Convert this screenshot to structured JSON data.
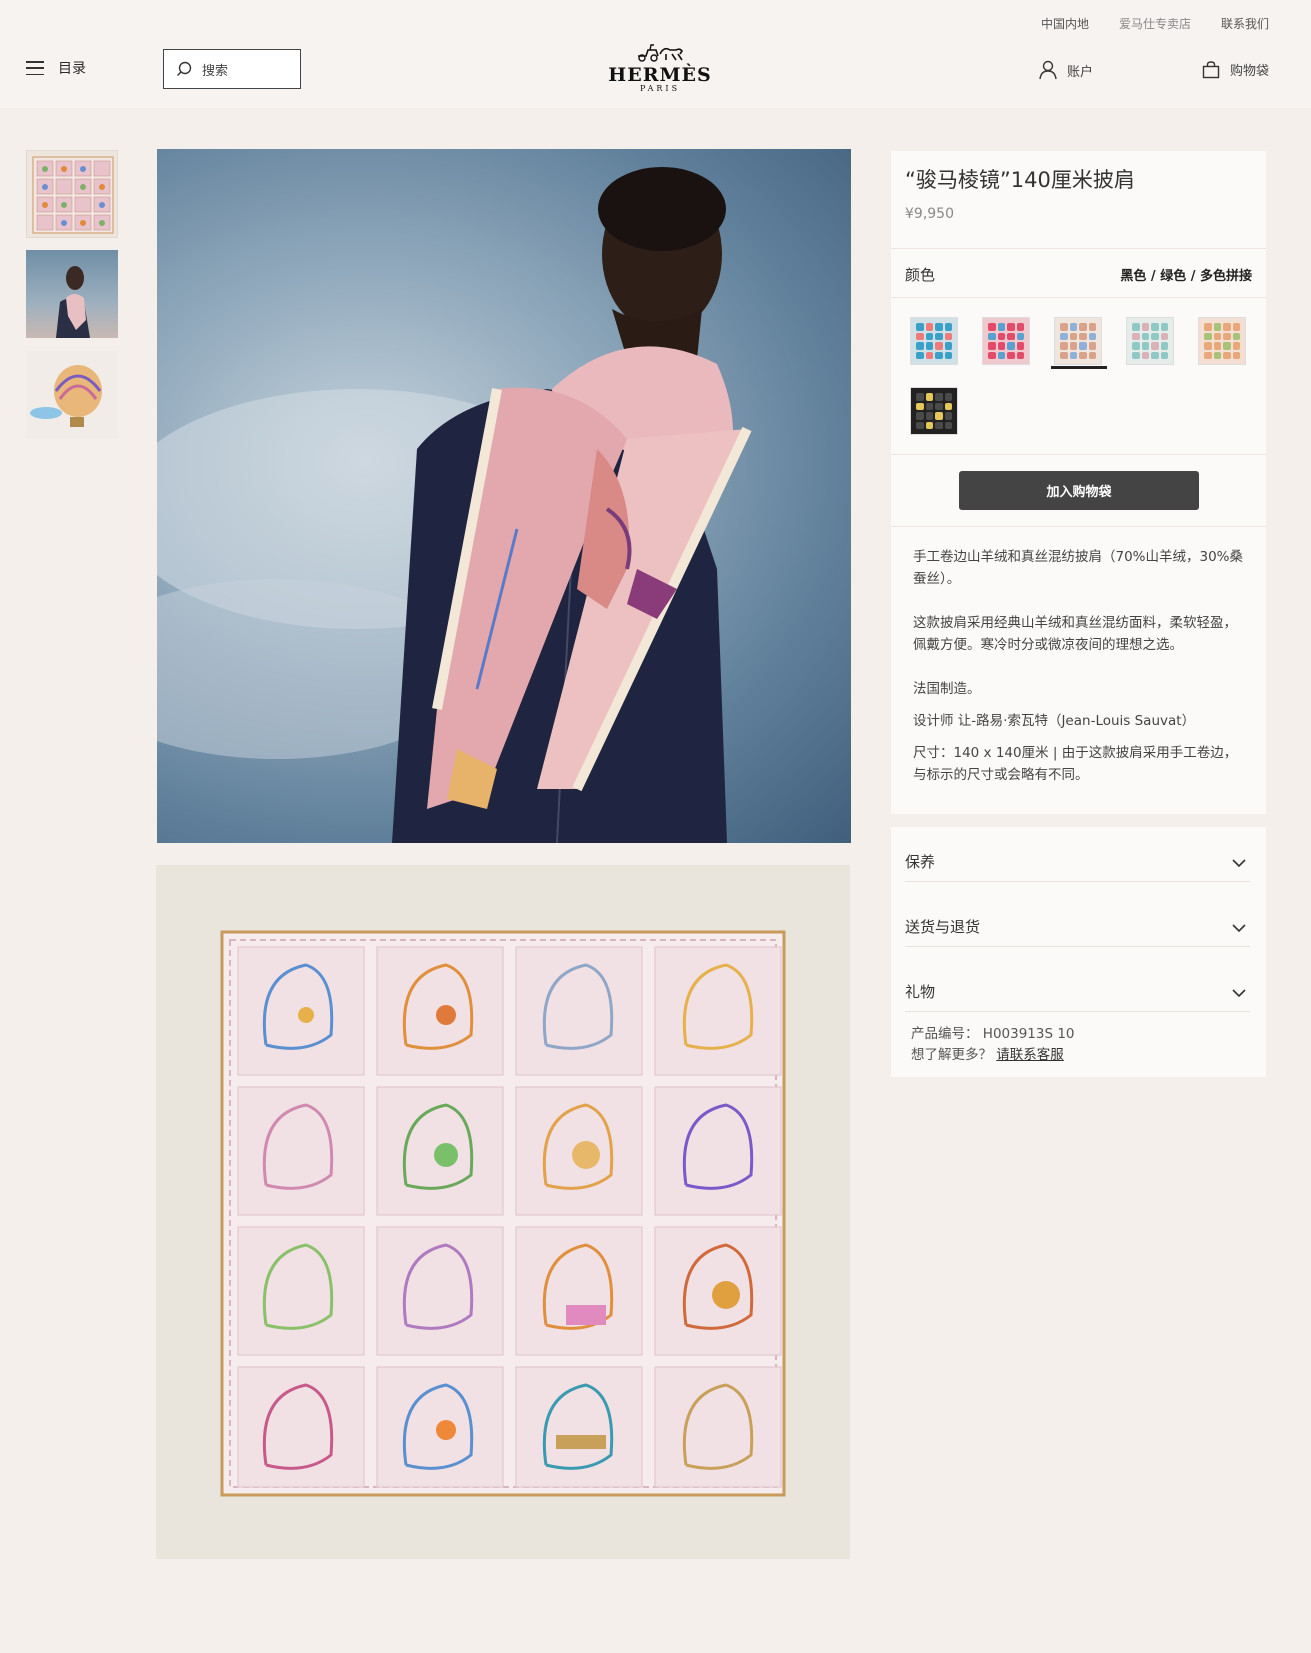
{
  "header": {
    "top_links": [
      "中国内地",
      "爱马仕专卖店",
      "联系我们"
    ],
    "menu_label": "目录",
    "search_placeholder": "搜索",
    "logo_word": "HERMÈS",
    "logo_sub": "PARIS",
    "account_label": "账户",
    "bag_label": "购物袋"
  },
  "product": {
    "title": "“骏马棱镜”140厘米披肩",
    "price": "¥9,950",
    "color_label": "颜色",
    "color_value": "黑色 / 绿色 / 多色拼接",
    "swatches": [
      {
        "name": "blue",
        "bg": "#cfe0e6",
        "tile": "#3aa0c8",
        "accent": "#f07a7a"
      },
      {
        "name": "pink",
        "bg": "#f0c9cf",
        "tile": "#e24c6a",
        "accent": "#5aa0d0"
      },
      {
        "name": "beige-selected",
        "bg": "#efe5dd",
        "tile": "#d9a28a",
        "accent": "#8fb0d8"
      },
      {
        "name": "mint",
        "bg": "#e6ecea",
        "tile": "#8fc8c4",
        "accent": "#d9b1b6"
      },
      {
        "name": "peach",
        "bg": "#f3e0d2",
        "tile": "#e8a87c",
        "accent": "#a9c27a"
      },
      {
        "name": "black",
        "bg": "#222222",
        "tile": "#4a4a4a",
        "accent": "#e6c85a"
      }
    ],
    "add_to_cart": "加入购物袋",
    "description": [
      "手工卷边山羊绒和真丝混纺披肩（70%山羊绒，30%桑蚕丝）。",
      "这款披肩采用经典山羊绒和真丝混纺面料，柔软轻盈，佩戴方便。寒冷时分或微凉夜间的理想之选。",
      "法国制造。",
      "设计师 让-路易·索瓦特（Jean-Louis Sauvat）",
      "尺寸：140 x 140厘米 | 由于这款披肩采用手工卷边，与标示的尺寸或会略有不同。"
    ]
  },
  "accordion": [
    "保养",
    "送货与退货",
    "礼物"
  ],
  "reference": {
    "label": "产品编号：",
    "code": "H003913S 10",
    "question": "想了解更多？",
    "link": "请联系客服"
  }
}
